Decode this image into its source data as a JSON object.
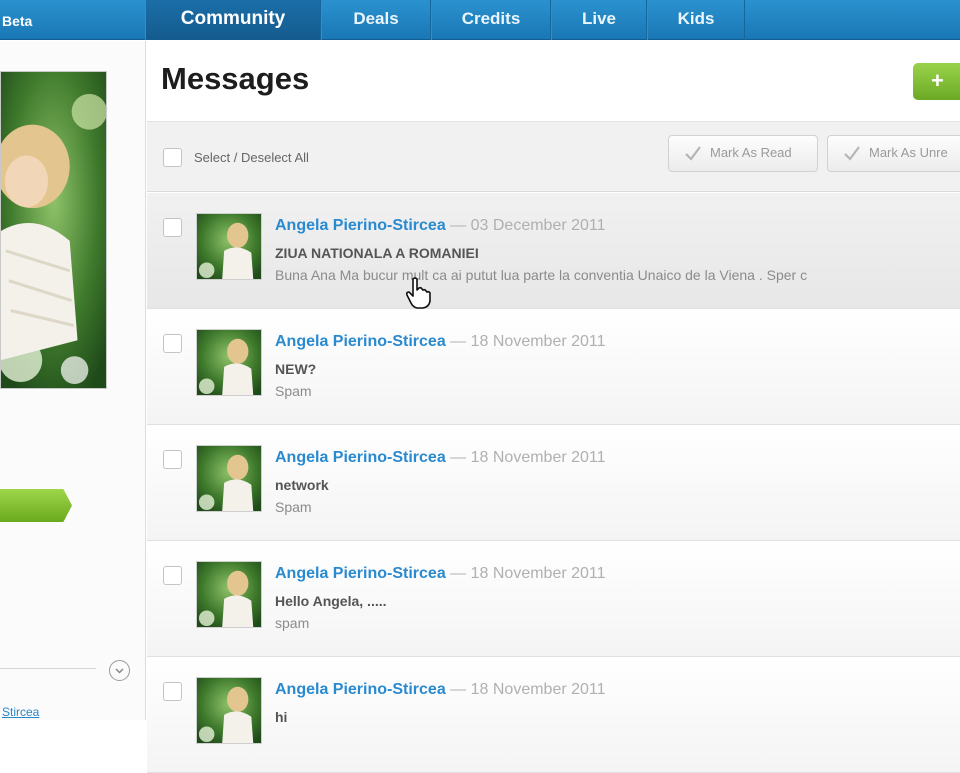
{
  "header": {
    "brand": "Beta",
    "tabs": [
      {
        "label": "Community",
        "active": true
      },
      {
        "label": "Deals"
      },
      {
        "label": "Credits"
      },
      {
        "label": "Live"
      },
      {
        "label": "Kids"
      }
    ]
  },
  "sidebar": {
    "link_text": "Stircea"
  },
  "main": {
    "title": "Messages",
    "new_button_icon": "plus-icon",
    "new_button_label": "+"
  },
  "toolbar": {
    "select_all_label": "Select / Deselect All",
    "mark_read_label": "Mark As Read",
    "mark_unread_label": "Mark As Unre"
  },
  "messages": [
    {
      "sender": "Angela Pierino-Stircea",
      "date": "— 03 December 2011",
      "subject": "ZIUA NATIONALA A ROMANIEI",
      "preview": "Buna Ana Ma bucur mult ca ai putut lua parte la conventia Unaico de la Viena . Sper c",
      "highlighted": true
    },
    {
      "sender": "Angela Pierino-Stircea",
      "date": "— 18 November 2011",
      "subject": "NEW?",
      "preview": "Spam"
    },
    {
      "sender": "Angela Pierino-Stircea",
      "date": "— 18 November 2011",
      "subject": "network",
      "preview": "Spam"
    },
    {
      "sender": "Angela Pierino-Stircea",
      "date": "— 18 November 2011",
      "subject": "Hello Angela, .....",
      "preview": "spam"
    },
    {
      "sender": "Angela Pierino-Stircea",
      "date": "— 18 November 2011",
      "subject": "hi",
      "preview": ""
    }
  ],
  "colors": {
    "nav_blue": "#1a77b5",
    "link_blue": "#2a8ad0",
    "green_accent": "#7ab733"
  }
}
